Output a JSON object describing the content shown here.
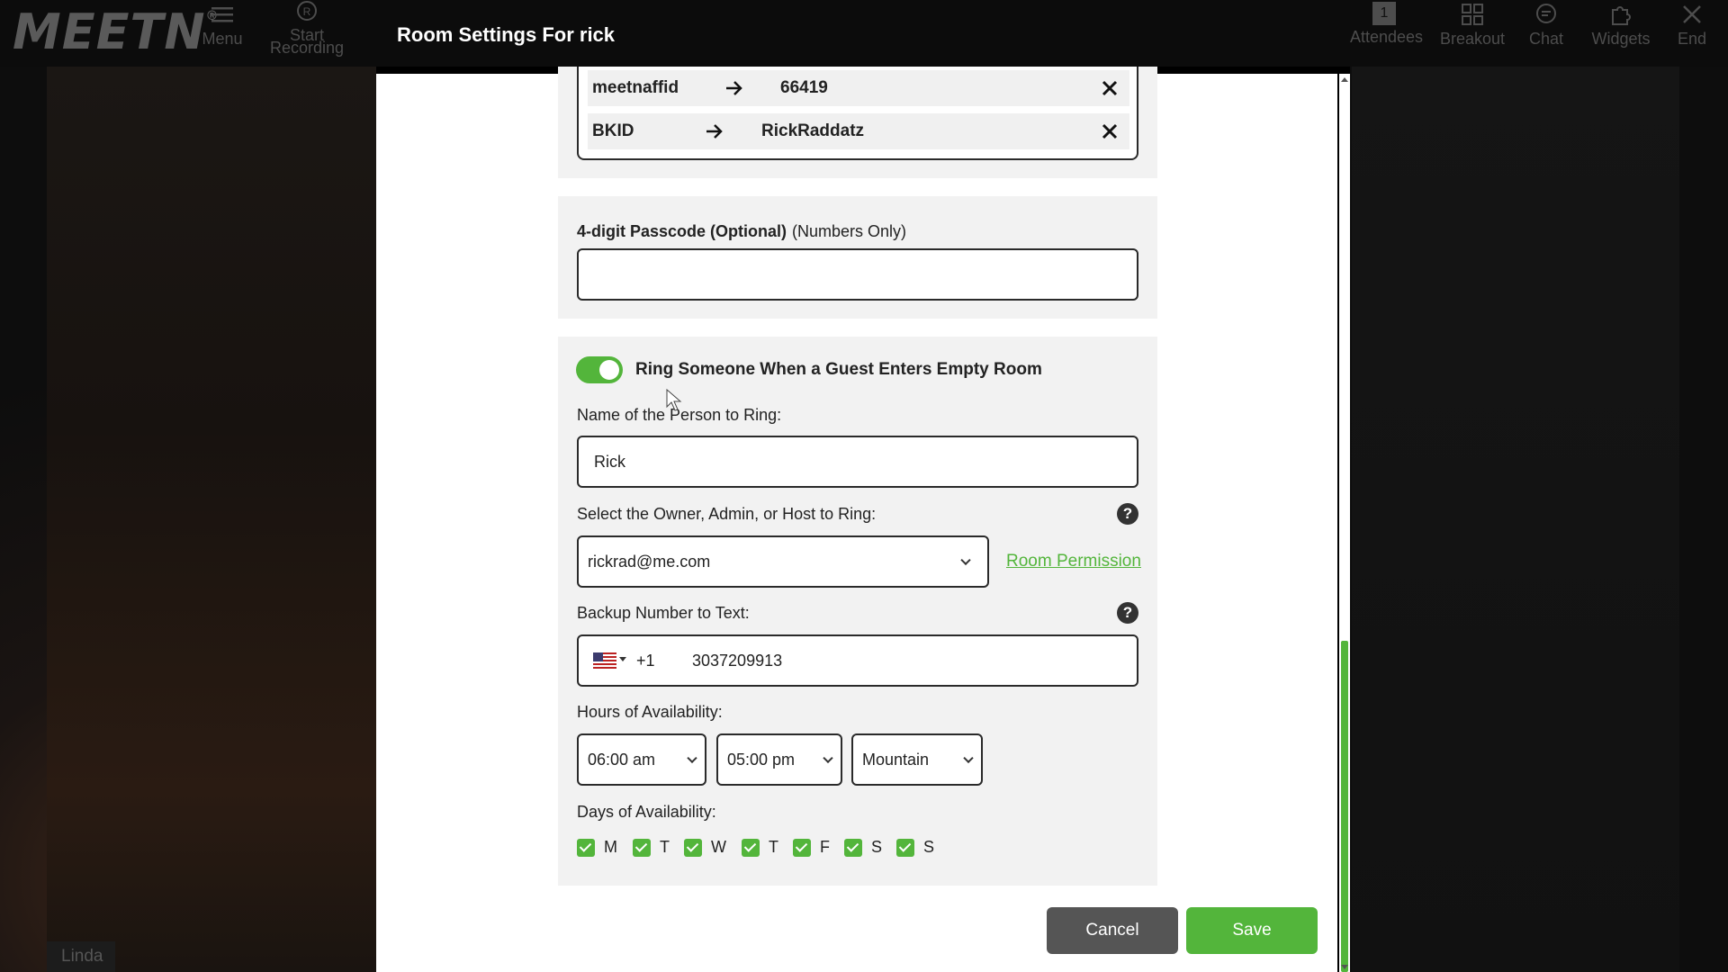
{
  "topbar": {
    "logo": "MEETN",
    "logo_mark": "®",
    "menu_label": "Menu",
    "recording_label": "Start\nRecording",
    "attendees_count": "1",
    "attendees_label": "Attendees",
    "breakout_label": "Breakout",
    "chat_label": "Chat",
    "widgets_label": "Widgets",
    "end_label": "End"
  },
  "modal": {
    "title": "Room Settings For rick"
  },
  "mappings": [
    {
      "key": "meetnaffid",
      "value": "66419"
    },
    {
      "key": "BKID",
      "value": "RickRaddatz"
    }
  ],
  "passcode": {
    "label": "4-digit Passcode (Optional)",
    "hint": "(Numbers Only)",
    "value": ""
  },
  "ring": {
    "toggle_label": "Ring Someone When a Guest Enters Empty Room",
    "enabled": true,
    "name_label": "Name of the Person to Ring:",
    "name_value": "Rick",
    "owner_label": "Select the Owner, Admin, or Host to Ring:",
    "owner_value": "rickrad@me.com",
    "room_permission_link": "Room Permission",
    "backup_label": "Backup Number to Text:",
    "country_code": "+1",
    "phone_value": "3037209913",
    "hours_label": "Hours of Availability:",
    "start_time": "06:00 am",
    "end_time": "05:00 pm",
    "timezone": "Mountain",
    "days_label": "Days of Availability:",
    "days": [
      "M",
      "T",
      "W",
      "T",
      "F",
      "S",
      "S"
    ]
  },
  "buttons": {
    "cancel": "Cancel",
    "save": "Save"
  },
  "video": {
    "participant_name": "Linda"
  },
  "colors": {
    "accent": "#53b53b",
    "cancel": "#555555",
    "section_bg": "#f2f2f2"
  }
}
